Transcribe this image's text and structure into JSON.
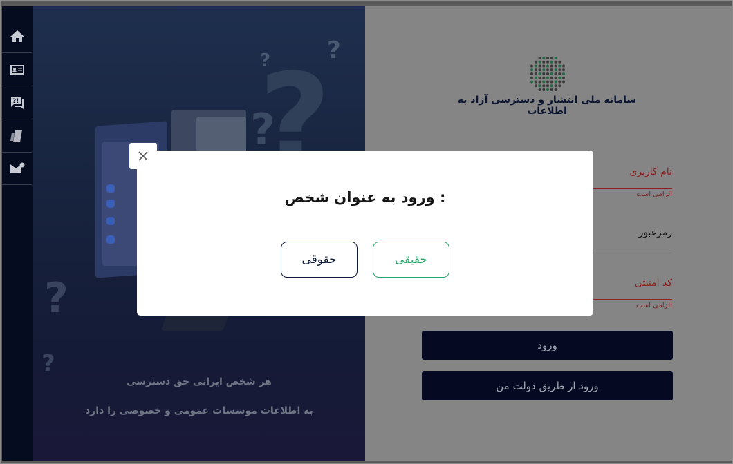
{
  "sidebar": {
    "items": [
      {
        "icon": "home-icon"
      },
      {
        "icon": "id-card-icon"
      },
      {
        "icon": "question-chat-icon"
      },
      {
        "icon": "documents-icon"
      },
      {
        "icon": "mail-icon"
      }
    ]
  },
  "illustration": {
    "caption_line1": "هر شخص ایرانی حق دسترسی",
    "caption_line2": "به اطلاعات موسسات عمومی و خصوصی را دارد"
  },
  "login": {
    "logo_text": "سامانه ملی انتشار و دسترسی آزاد به اطلاعات",
    "username_label": "نام کاربری",
    "username_hint": "الزامی است",
    "password_label": "رمزعبور",
    "captcha_label": "کد امنیتی",
    "captcha_hint": "الزامی است",
    "login_button": "ورود",
    "gov_login_button": "ورود از طریق دولت من"
  },
  "modal": {
    "title": "ورود به عنوان شخص :",
    "real_person_button": "حقیقی",
    "legal_person_button": "حقوقی",
    "colors": {
      "real": "#29a86a",
      "legal": "#0c1a3a"
    }
  }
}
